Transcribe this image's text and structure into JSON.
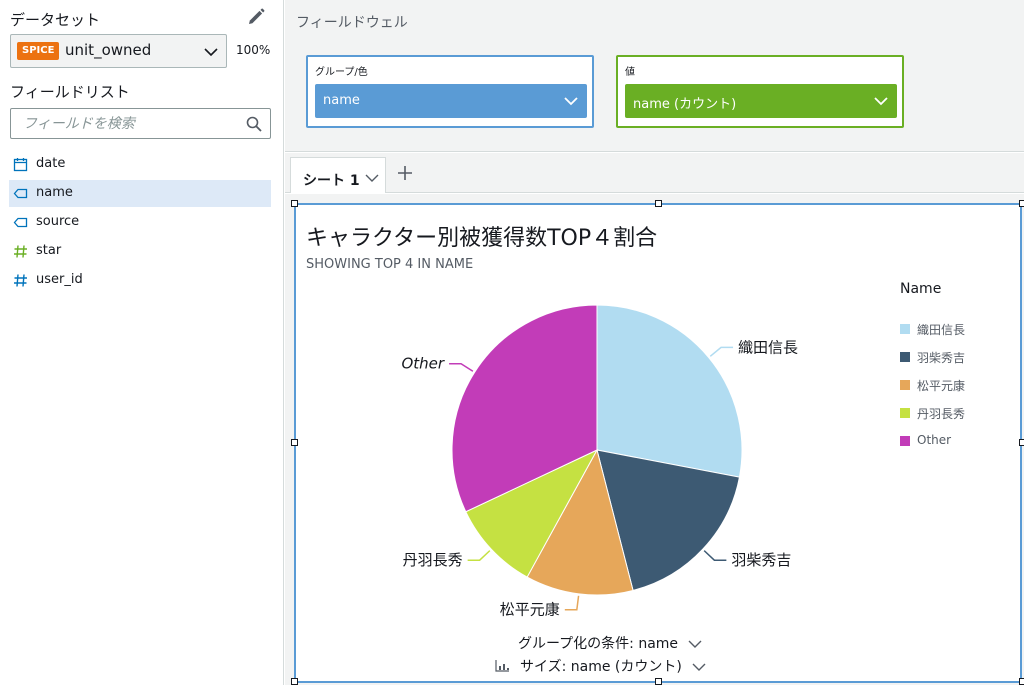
{
  "sidebar": {
    "dataset_title": "データセット",
    "dataset": {
      "badge": "SPICE",
      "name": "unit_owned",
      "percent": "100%"
    },
    "field_list_title": "フィールドリスト",
    "search_placeholder": "フィールドを検索",
    "fields": [
      {
        "label": "date",
        "type": "date",
        "icon": "calendar-icon"
      },
      {
        "label": "name",
        "type": "dimension",
        "icon": "tag-icon",
        "selected": true
      },
      {
        "label": "source",
        "type": "dimension",
        "icon": "tag-icon"
      },
      {
        "label": "star",
        "type": "measure",
        "icon": "hash-icon"
      },
      {
        "label": "user_id",
        "type": "measure",
        "icon": "hash-icon"
      }
    ]
  },
  "field_well": {
    "title": "フィールドウェル",
    "group": {
      "label": "グループ/色",
      "field": "name"
    },
    "value": {
      "label": "値",
      "field": "name (カウント)"
    }
  },
  "tabs": {
    "sheet_label": "シート 1"
  },
  "visual": {
    "subtitle": "SHOWING TOP 4 IN NAME",
    "legend_title": "Name",
    "footer_group": "グループ化の条件: name",
    "footer_size": "サイズ: name (カウント)"
  },
  "chart_data": {
    "type": "pie",
    "title": "キャラクター別被獲得数TOP４割合",
    "subtitle": "SHOWING TOP 4 IN NAME",
    "legend_title": "Name",
    "legend_position": "right",
    "slices": [
      {
        "label": "織田信長",
        "value": 28,
        "color": "#b1dcf1"
      },
      {
        "label": "羽柴秀吉",
        "value": 18,
        "color": "#3d5a73"
      },
      {
        "label": "松平元康",
        "value": 12,
        "color": "#e6a75a"
      },
      {
        "label": "丹羽長秀",
        "value": 10,
        "color": "#c5e142"
      },
      {
        "label": "Other",
        "value": 32,
        "color": "#c23cb8"
      }
    ]
  },
  "colors": {
    "accent_blue": "#5a9bd5",
    "accent_green": "#6aaf24",
    "spice_orange": "#ec7211",
    "selected_bg": "#dde9f7"
  }
}
